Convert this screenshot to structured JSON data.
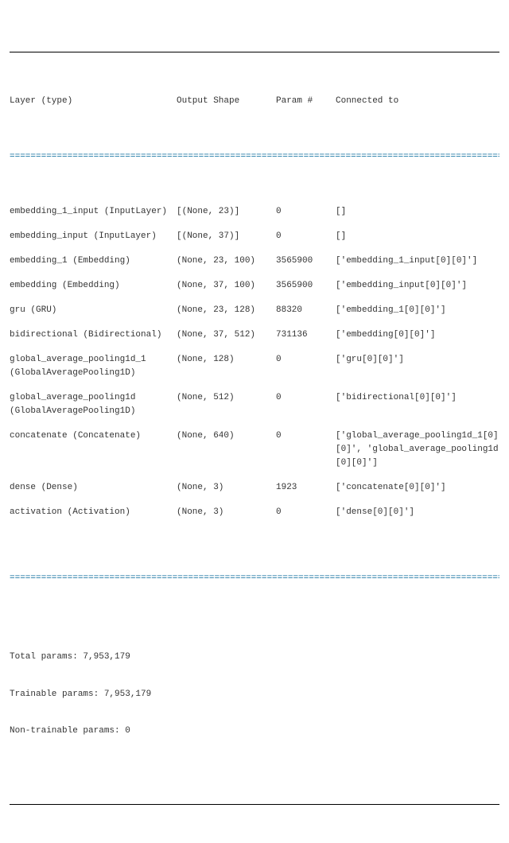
{
  "headers": {
    "layer": "Layer (type)",
    "shape": "Output Shape",
    "param": "Param #",
    "conn": "Connected to"
  },
  "rows": [
    {
      "layer": "embedding_1_input (InputLayer)",
      "shape": "[(None, 23)]",
      "param": "0",
      "conn": "[]"
    },
    {
      "layer": "embedding_input (InputLayer)",
      "shape": "[(None, 37)]",
      "param": "0",
      "conn": "[]"
    },
    {
      "layer": "embedding_1 (Embedding)",
      "shape": "(None, 23, 100)",
      "param": "3565900",
      "conn": "['embedding_1_input[0][0]']"
    },
    {
      "layer": "embedding (Embedding)",
      "shape": "(None, 37, 100)",
      "param": "3565900",
      "conn": "['embedding_input[0][0]']"
    },
    {
      "layer": "gru (GRU)",
      "shape": "(None, 23, 128)",
      "param": "88320",
      "conn": "['embedding_1[0][0]']"
    },
    {
      "layer": "bidirectional (Bidirectional)",
      "shape": "(None, 37, 512)",
      "param": "731136",
      "conn": "['embedding[0][0]']"
    },
    {
      "layer": "global_average_pooling1d_1 (GlobalAveragePooling1D)",
      "shape": "(None, 128)",
      "param": "0",
      "conn": "['gru[0][0]']"
    },
    {
      "layer": "global_average_pooling1d (GlobalAveragePooling1D)",
      "shape": "(None, 512)",
      "param": "0",
      "conn": "['bidirectional[0][0]']"
    },
    {
      "layer": "concatenate (Concatenate)",
      "shape": "(None, 640)",
      "param": "0",
      "conn": "['global_average_pooling1d_1[0][0]',\n 'global_average_pooling1d[0][0]']"
    },
    {
      "layer": "dense (Dense)",
      "shape": "(None, 3)",
      "param": "1923",
      "conn": "['concatenate[0][0]']"
    },
    {
      "layer": "activation (Activation)",
      "shape": "(None, 3)",
      "param": "0",
      "conn": "['dense[0][0]']"
    }
  ],
  "rule": "==================================================================================================",
  "totals": {
    "total": "Total params: 7,953,179",
    "trainable": "Trainable params: 7,953,179",
    "nontrainable": "Non-trainable params: 0"
  }
}
